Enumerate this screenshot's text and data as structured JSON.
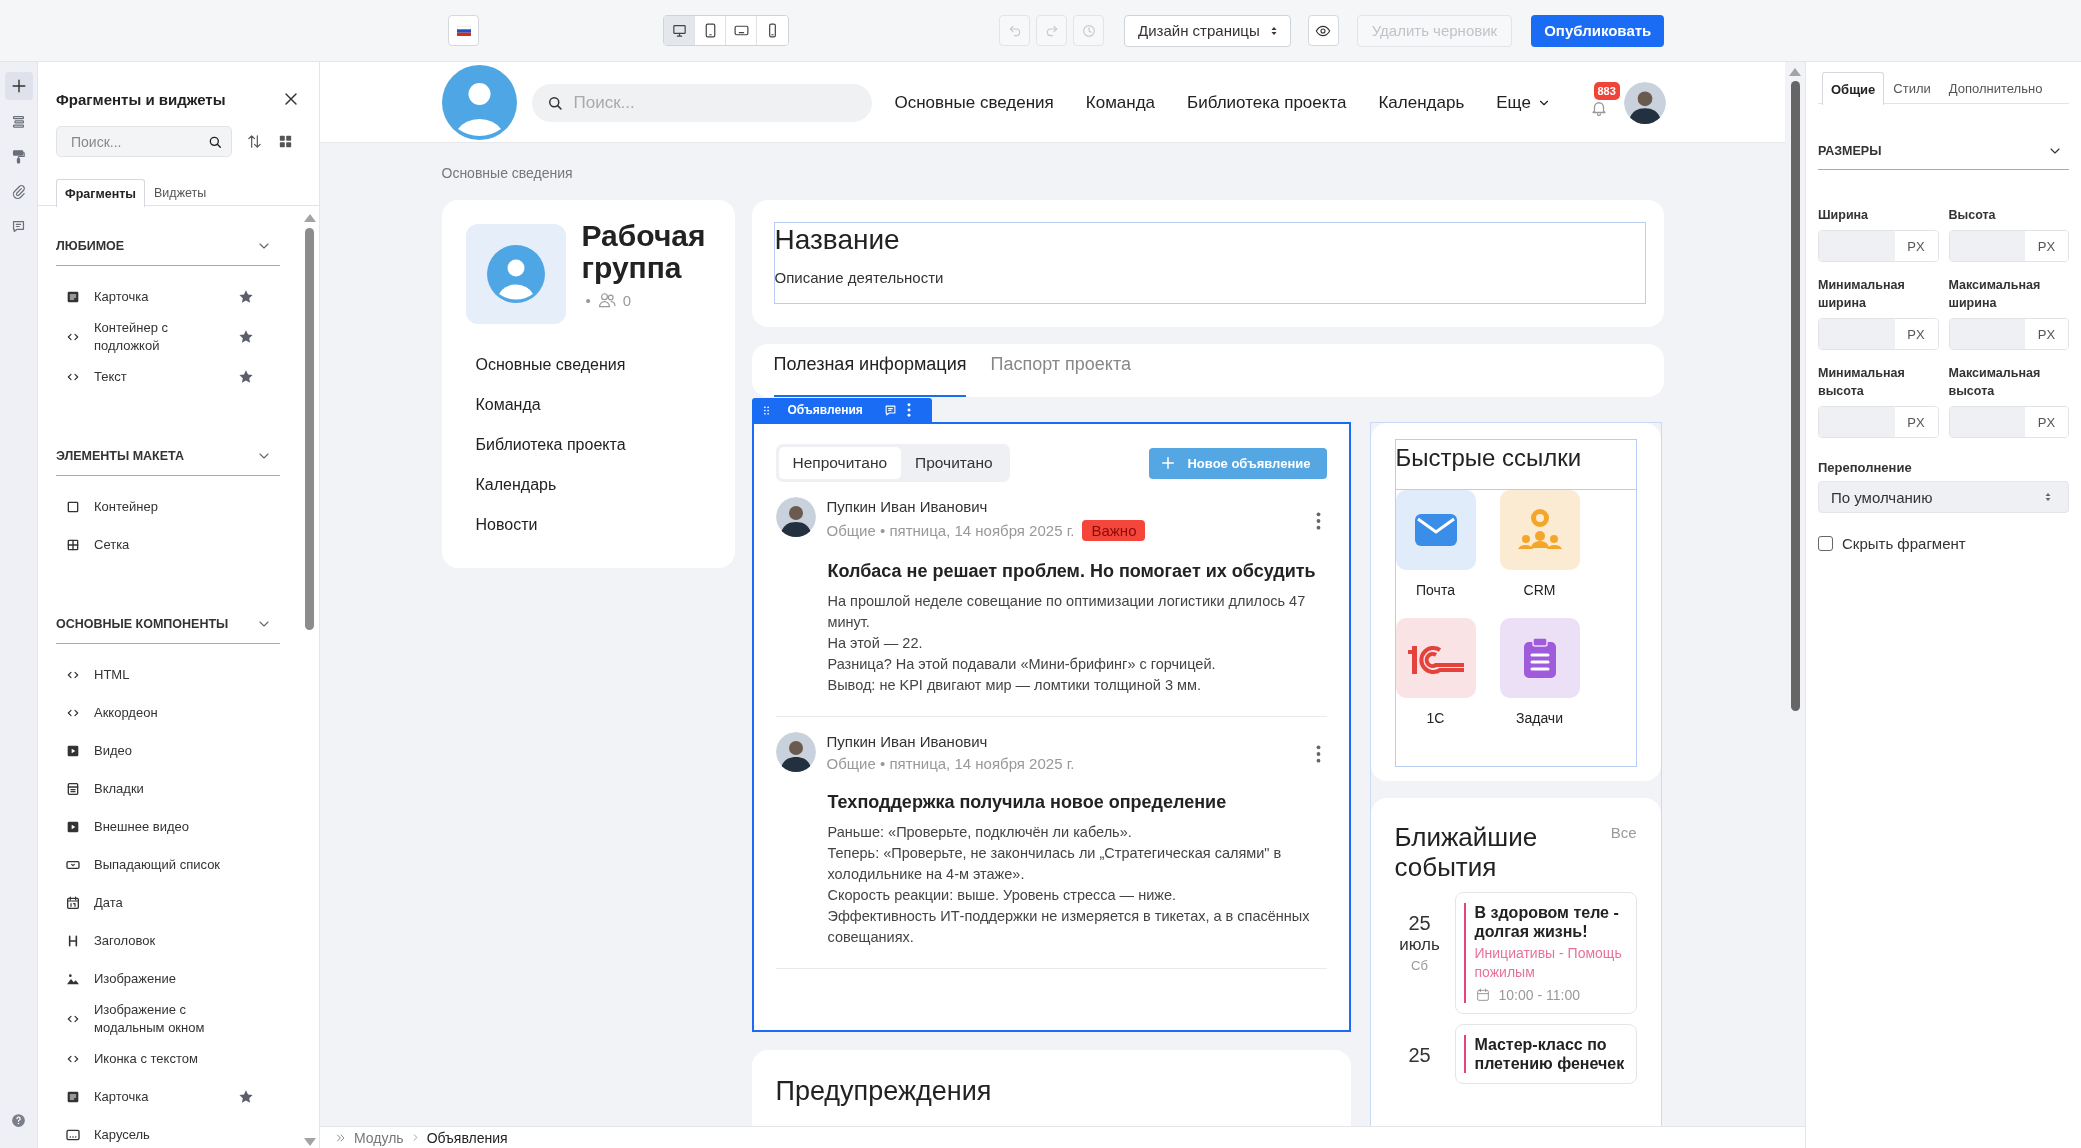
{
  "top_bar": {
    "devices": [
      {
        "kind": "desktop",
        "selected": true
      },
      {
        "kind": "tablet",
        "selected": false
      },
      {
        "kind": "tablet-landscape",
        "selected": false
      },
      {
        "kind": "phone",
        "selected": false
      }
    ],
    "history": [
      {
        "kind": "undo",
        "disabled": true
      },
      {
        "kind": "redo",
        "disabled": true
      },
      {
        "kind": "history",
        "disabled": true
      }
    ],
    "mode_select": "Дизайн страницы",
    "delete_draft": {
      "label": "Удалить черновик",
      "disabled": true
    },
    "publish": {
      "label": "Опубликовать",
      "disabled": false
    }
  },
  "rail": [
    {
      "kind": "add",
      "selected": true
    },
    {
      "kind": "layers",
      "selected": false
    },
    {
      "kind": "styles",
      "selected": false
    },
    {
      "kind": "attachments",
      "selected": false
    },
    {
      "kind": "comments",
      "selected": false
    }
  ],
  "library": {
    "title": "Фрагменты и виджеты",
    "search_placeholder": "Поиск...",
    "tabs": [
      {
        "label": "Фрагменты",
        "selected": true
      },
      {
        "label": "Виджеты",
        "selected": false
      }
    ],
    "sections": [
      {
        "title": "ЛЮБИМОЕ",
        "expanded": true,
        "items": [
          {
            "kind": "card",
            "label": "Карточка",
            "favorite": true
          },
          {
            "kind": "code",
            "label": "Контейнер с подложкой",
            "favorite": true
          },
          {
            "kind": "code",
            "label": "Текст",
            "favorite": true
          }
        ]
      },
      {
        "title": "ЭЛЕМЕНТЫ МАКЕТА",
        "expanded": true,
        "items": [
          {
            "kind": "container",
            "label": "Контейнер",
            "favorite": false
          },
          {
            "kind": "grid",
            "label": "Сетка",
            "favorite": false
          }
        ]
      },
      {
        "title": "ОСНОВНЫЕ КОМПОНЕНТЫ",
        "expanded": true,
        "items": [
          {
            "kind": "code",
            "label": "HTML",
            "favorite": false
          },
          {
            "kind": "code",
            "label": "Аккордеон",
            "favorite": false
          },
          {
            "kind": "video",
            "label": "Видео",
            "favorite": false
          },
          {
            "kind": "tabs",
            "label": "Вкладки",
            "favorite": false
          },
          {
            "kind": "video",
            "label": "Внешнее видео",
            "favorite": false
          },
          {
            "kind": "dropdown",
            "label": "Выпадающий список",
            "favorite": false
          },
          {
            "kind": "date",
            "label": "Дата",
            "favorite": false
          },
          {
            "kind": "heading",
            "label": "Заголовок",
            "favorite": false
          },
          {
            "kind": "image",
            "label": "Изображение",
            "favorite": false
          },
          {
            "kind": "code",
            "label": "Изображение с модальным окном",
            "favorite": false
          },
          {
            "kind": "code",
            "label": "Иконка с текстом",
            "favorite": false
          },
          {
            "kind": "card",
            "label": "Карточка",
            "favorite": true
          },
          {
            "kind": "carousel",
            "label": "Карусель",
            "favorite": false
          }
        ]
      }
    ]
  },
  "site": {
    "search_placeholder": "Поиск...",
    "nav": [
      "Основные сведения",
      "Команда",
      "Библиотека проекта",
      "Календарь"
    ],
    "more": "Еще",
    "notifications": "883",
    "breadcrumb": "Основные сведения",
    "group": {
      "title": "Рабочая группа",
      "separator": "•",
      "members": "0",
      "menu": [
        "Основные сведения",
        "Команда",
        "Библиотека проекта",
        "Календарь",
        "Новости"
      ]
    },
    "name_block": {
      "title": "Название",
      "description": "Описание деятельности"
    },
    "tabs": [
      {
        "label": "Полезная информация",
        "selected": true
      },
      {
        "label": "Паспорт проекта",
        "selected": false
      }
    ],
    "announcements": {
      "widget_label": "Объявления",
      "filters": [
        {
          "label": "Непрочитано",
          "selected": true
        },
        {
          "label": "Прочитано",
          "selected": false
        }
      ],
      "new_button": "Новое объявление",
      "posts": [
        {
          "author": "Пупкин Иван Иванович",
          "meta": "Общие • пятница, 14 ноября 2025 г.",
          "badge": "Важно",
          "title": "Колбаса не решает проблем. Но помогает их обсудить",
          "body": [
            "На прошлой неделе совещание по оптимизации логистики длилось 47 минут.",
            "На этой — 22.",
            "Разница? На этой подавали «Мини-брифинг» с горчицей.",
            "Вывод: не KPI двигают мир — ломтики толщиной 3 мм."
          ]
        },
        {
          "author": "Пупкин Иван Иванович",
          "meta": "Общие • пятница, 14 ноября 2025 г.",
          "title": "Техподдержка получила новое определение",
          "body": [
            "Раньше: «Проверьте, подключён ли кабель».",
            "Теперь: «Проверьте, не закончилась ли „Стратегическая салями\" в холодильнике на 4-м этаже».",
            "Скорость реакции: выше. Уровень стресса — ниже.",
            "Эффективность ИТ-поддержки не измеряется в тикетах, а в спасённых совещаниях."
          ]
        }
      ]
    },
    "warnings": {
      "title": "Предупреждения"
    },
    "quick_links": {
      "title": "Быстрые ссылки",
      "links": [
        {
          "kind": "mail",
          "label": "Почта"
        },
        {
          "kind": "crm",
          "label": "CRM"
        },
        {
          "kind": "accounting",
          "label": "1С"
        },
        {
          "kind": "tasks",
          "label": "Задачи"
        }
      ]
    },
    "events": {
      "title": "Ближайшие события",
      "all_link": "Все",
      "items": [
        {
          "day": "25",
          "month": "июль",
          "weekday": "Сб",
          "title": "В здоровом теле - долгая жизнь!",
          "category": "Инициативы - Помощь пожилым",
          "time": "10:00 - 11:00"
        },
        {
          "day": "25",
          "title": "Мастер-класс по плетению фенечек"
        }
      ]
    }
  },
  "status_path": [
    "Модуль",
    "Объявления"
  ],
  "properties": {
    "tabs": [
      {
        "label": "Общие",
        "selected": true
      },
      {
        "label": "Стили",
        "selected": false
      },
      {
        "label": "Дополнительно",
        "selected": false
      }
    ],
    "section": {
      "title": "РАЗМЕРЫ",
      "expanded": true
    },
    "fields": [
      {
        "label": "Ширина",
        "unit": "PX"
      },
      {
        "label": "Высота",
        "unit": "PX"
      },
      {
        "label": "Минимальная ширина",
        "unit": "PX"
      },
      {
        "label": "Максимальная ширина",
        "unit": "PX"
      },
      {
        "label": "Минимальная высота",
        "unit": "PX"
      },
      {
        "label": "Максимальная высота",
        "unit": "PX"
      }
    ],
    "overflow": {
      "label": "Переполнение",
      "value": "По умолчанию"
    },
    "hide_fragment": {
      "label": "Скрыть фрагмент",
      "checked": false
    }
  }
}
